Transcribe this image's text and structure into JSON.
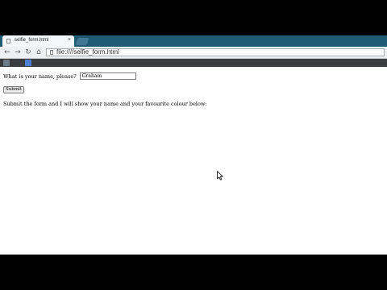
{
  "browser": {
    "tab": {
      "title": "selfie_form.html",
      "close_glyph": "×"
    },
    "toolbar": {
      "back_glyph": "←",
      "forward_glyph": "→",
      "reload_glyph": "↻",
      "home_glyph": "⌂",
      "url": "file:////selfie_form.html"
    }
  },
  "page": {
    "name_prompt": "What is your name, please?",
    "name_value": "Graham",
    "submit_label": "Submit",
    "result_text": "Submit the form and I will show your name and your favourite colour below:"
  },
  "icons": [
    "page-icon",
    "close-icon",
    "new-tab-icon",
    "back-arrow-icon",
    "forward-arrow-icon",
    "reload-icon",
    "home-icon",
    "bookmark-icon",
    "mouse-cursor-icon"
  ]
}
